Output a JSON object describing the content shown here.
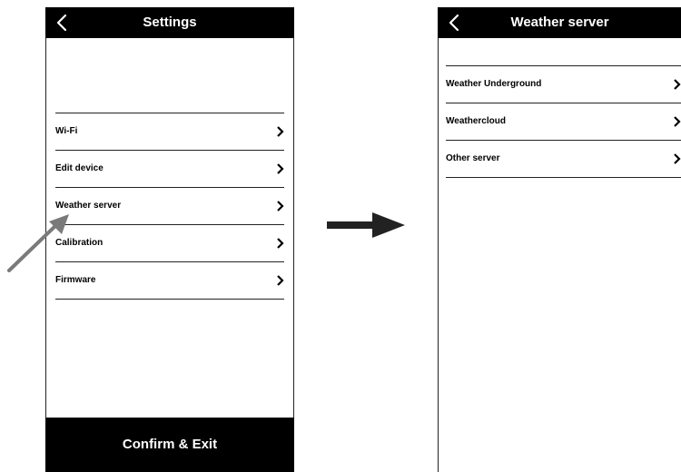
{
  "left_screen": {
    "title": "Settings",
    "menu": [
      {
        "label": "Wi-Fi"
      },
      {
        "label": "Edit device"
      },
      {
        "label": "Weather server"
      },
      {
        "label": "Calibration"
      },
      {
        "label": "Firmware"
      }
    ],
    "footer_button": "Confirm & Exit"
  },
  "right_screen": {
    "title": "Weather server",
    "menu": [
      {
        "label": "Weather Underground"
      },
      {
        "label": "Weathercloud"
      },
      {
        "label": "Other server"
      }
    ]
  },
  "icons": {
    "back": "chevron-left-icon",
    "item": "chevron-right-icon",
    "flow": "arrow-right-icon",
    "pointer": "pointer-arrow-icon"
  },
  "colors": {
    "header": "#000000",
    "pointer": "#7a7a7a"
  }
}
